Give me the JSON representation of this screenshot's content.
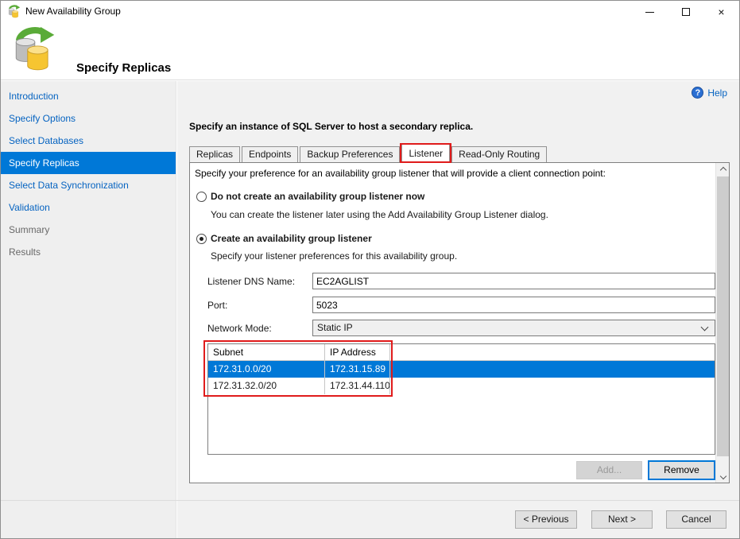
{
  "window": {
    "title": "New Availability Group"
  },
  "icons": {
    "close_glyph": "×",
    "help_glyph": "?"
  },
  "header": {
    "title": "Specify Replicas"
  },
  "sidebar": {
    "items": [
      {
        "label": "Introduction",
        "state": "link"
      },
      {
        "label": "Specify Options",
        "state": "link"
      },
      {
        "label": "Select Databases",
        "state": "link"
      },
      {
        "label": "Specify Replicas",
        "state": "selected"
      },
      {
        "label": "Select Data Synchronization",
        "state": "link"
      },
      {
        "label": "Validation",
        "state": "link"
      },
      {
        "label": "Summary",
        "state": "disabled"
      },
      {
        "label": "Results",
        "state": "disabled"
      }
    ]
  },
  "main": {
    "help_label": "Help",
    "instruction": "Specify an instance of SQL Server to host a secondary replica.",
    "tabs": [
      {
        "label": "Replicas"
      },
      {
        "label": "Endpoints"
      },
      {
        "label": "Backup Preferences"
      },
      {
        "label": "Listener"
      },
      {
        "label": "Read-Only Routing"
      }
    ],
    "active_tab": "Listener",
    "listener": {
      "intro": "Specify your preference for an availability group listener that will provide a client connection point:",
      "radio_options": [
        {
          "label": "Do not create an availability group listener now",
          "description": "You can create the listener later using the Add Availability Group Listener dialog.",
          "selected": false
        },
        {
          "label": "Create an availability group listener",
          "description": "Specify your listener preferences for this availability group.",
          "selected": true
        }
      ],
      "fields": [
        {
          "label": "Listener DNS Name:",
          "value": "EC2AGLIST"
        },
        {
          "label": "Port:",
          "value": "5023"
        },
        {
          "label": "Network Mode:",
          "value": "Static IP"
        }
      ],
      "ip_table": {
        "columns": [
          "Subnet",
          "IP Address"
        ],
        "rows": [
          {
            "subnet": "172.31.0.0/20",
            "ip": "172.31.15.89",
            "selected": true
          },
          {
            "subnet": "172.31.32.0/20",
            "ip": "172.31.44.110",
            "selected": false
          }
        ]
      },
      "add_label": "Add...",
      "remove_label": "Remove"
    },
    "footer": {
      "previous": "< Previous",
      "next": "Next >",
      "cancel": "Cancel"
    }
  },
  "colors": {
    "selection_blue": "#0078d7",
    "link_blue": "#0563c1",
    "annotation_red": "#e01b1b"
  }
}
